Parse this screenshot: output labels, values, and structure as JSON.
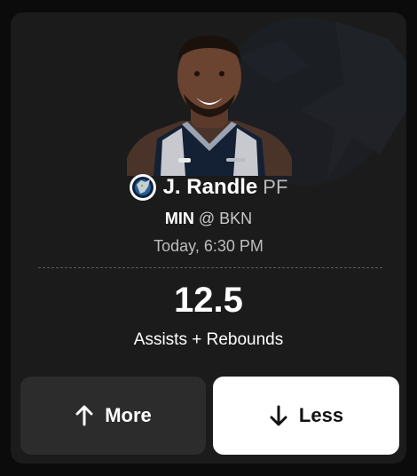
{
  "player": {
    "name": "J. Randle",
    "position": "PF",
    "team": "MIN",
    "jersey_brand": "sezzle"
  },
  "game": {
    "home_team": "MIN",
    "separator": "@",
    "away_team": "BKN",
    "time": "Today, 6:30 PM"
  },
  "projection": {
    "line": "12.5",
    "stat": "Assists + Rebounds"
  },
  "actions": {
    "more_label": "More",
    "less_label": "Less"
  },
  "colors": {
    "card_bg": "#1b1b1b",
    "more_bg": "#2c2c2c",
    "less_bg": "#ffffff",
    "team_navy": "#0c2340"
  }
}
